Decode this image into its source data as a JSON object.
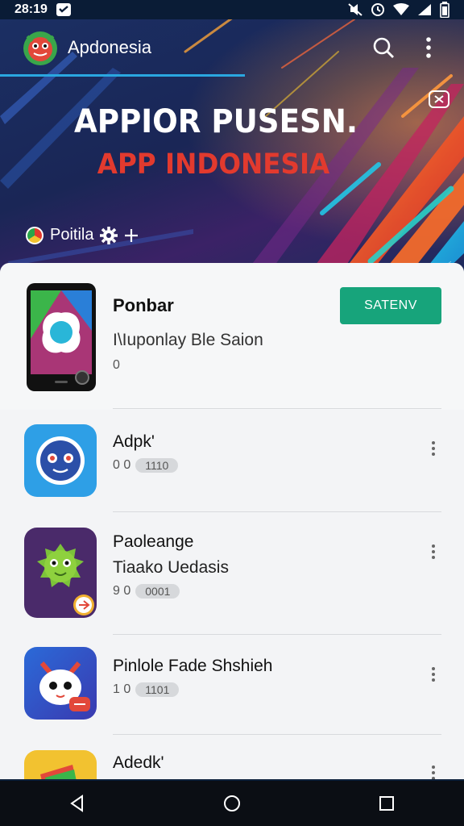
{
  "status_bar": {
    "time": "28:19",
    "icons": [
      "message-icon",
      "notification-muted-icon",
      "alarm-icon",
      "wifi-icon",
      "signal-icon",
      "battery-icon"
    ]
  },
  "app_bar": {
    "title": "Apdonesia",
    "actions": [
      "search-icon",
      "more-vert-icon"
    ]
  },
  "hero": {
    "title": "APPIOR PUSESN.",
    "subtitle": "APP INDONESIA",
    "meta_label": "Poitila",
    "meta_icons": [
      "settings-icon",
      "add-icon"
    ],
    "colors": {
      "title": "#ffffff",
      "subtitle": "#e23a2e",
      "accent": "#2aa7e0"
    }
  },
  "featured": {
    "name": "Ponbar",
    "description": "I\\Iuponlay Ble Saion",
    "rating": "0",
    "button_label": "SATENV",
    "button_color": "#17a47b"
  },
  "apps": [
    {
      "title": "Adpk'",
      "subtitle": "",
      "rating": "0 0",
      "pill": "1110",
      "icon": "blue-face-icon"
    },
    {
      "title": "Paoleange",
      "subtitle": "Tiaako Uedasis",
      "rating": "9 0",
      "pill": "0001",
      "icon": "green-monster-icon"
    },
    {
      "title": "Pinlole Fade Shshieh",
      "subtitle": "",
      "rating": "1 0",
      "pill": "1101",
      "icon": "white-creature-icon"
    },
    {
      "title": "Adedk'",
      "subtitle": "",
      "rating": "",
      "pill": "",
      "icon": "yellow-cards-icon"
    }
  ],
  "nav_bar": {
    "buttons": [
      "back-icon",
      "home-icon",
      "recents-icon"
    ]
  }
}
